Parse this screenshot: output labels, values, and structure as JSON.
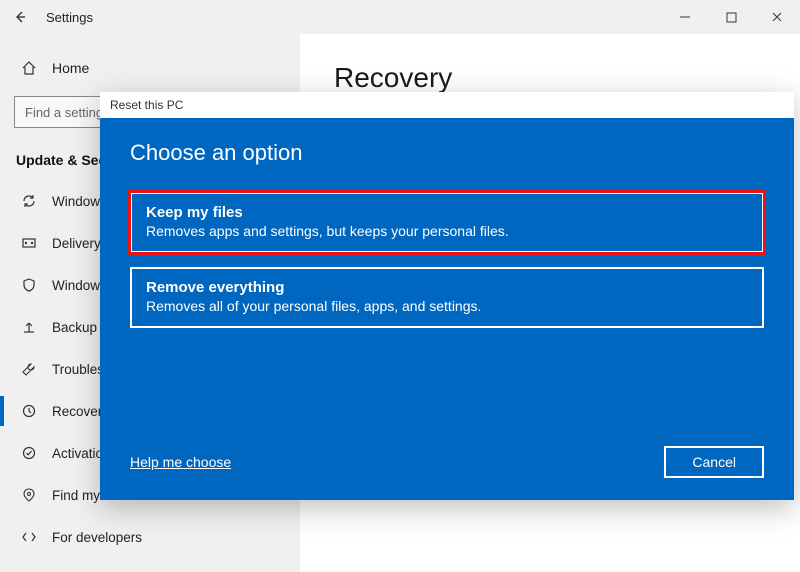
{
  "titlebar": {
    "app_title": "Settings"
  },
  "sidebar": {
    "home_label": "Home",
    "search_placeholder": "Find a setting",
    "section_header": "Update & Security",
    "items": [
      {
        "label": "Windows Update"
      },
      {
        "label": "Delivery Optimization"
      },
      {
        "label": "Windows Security"
      },
      {
        "label": "Backup"
      },
      {
        "label": "Troubleshoot"
      },
      {
        "label": "Recovery"
      },
      {
        "label": "Activation"
      },
      {
        "label": "Find my device"
      },
      {
        "label": "For developers"
      }
    ]
  },
  "main": {
    "heading": "Recovery"
  },
  "dialog": {
    "window_title": "Reset this PC",
    "heading": "Choose an option",
    "options": [
      {
        "title": "Keep my files",
        "desc": "Removes apps and settings, but keeps your personal files."
      },
      {
        "title": "Remove everything",
        "desc": "Removes all of your personal files, apps, and settings."
      }
    ],
    "help_link": "Help me choose",
    "cancel_label": "Cancel"
  }
}
